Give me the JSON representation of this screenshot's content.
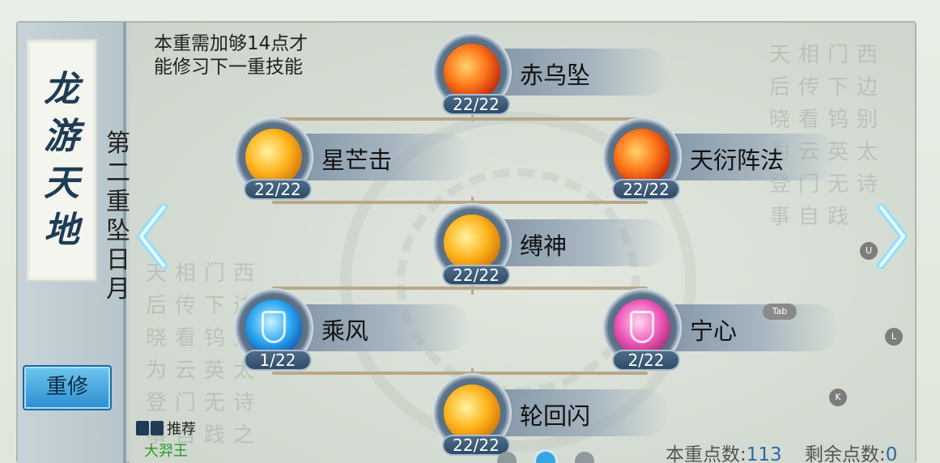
{
  "side_banner": {
    "calligraphy": [
      "龙",
      "游",
      "天",
      "地"
    ],
    "title_chars": [
      "第",
      "二",
      "重",
      "坠",
      "日",
      "月"
    ],
    "reset_label": "重修"
  },
  "hint": {
    "line1": "本重需加够14点才",
    "line2": "能修习下一重技能"
  },
  "deco_poem": {
    "right": [
      "天相门西",
      "后传下边",
      "晓看钨别",
      "为云英太",
      "登门无诗",
      "事自践"
    ],
    "left": [
      "天相门西",
      "后传下边",
      "晓看钨别",
      "为云英太",
      "登门无诗",
      "事自践之"
    ]
  },
  "skills": [
    {
      "name": "赤乌坠",
      "level": "22/22",
      "icon": "fire-claw-icon"
    },
    {
      "name": "星芒击",
      "level": "22/22",
      "icon": "golden-star-strike-icon"
    },
    {
      "name": "天衍阵法",
      "level": "22/22",
      "icon": "fire-formation-icon"
    },
    {
      "name": "缚神",
      "level": "22/22",
      "icon": "golden-bind-icon"
    },
    {
      "name": "乘风",
      "level": "1/22",
      "icon": "blue-shield-icon"
    },
    {
      "name": "宁心",
      "level": "2/22",
      "icon": "pink-shield-icon"
    },
    {
      "name": "轮回闪",
      "level": "22/22",
      "icon": "fire-phoenix-icon"
    }
  ],
  "key_hints": {
    "u": "U",
    "l": "L",
    "k": "K",
    "tab": "Tab"
  },
  "recommend": {
    "label": "推荐",
    "name": "大羿王"
  },
  "points": {
    "current_label": "本重点数:",
    "current_value": "113",
    "remaining_label": "剩余点数:",
    "remaining_value": "0"
  },
  "colors": {
    "accent_blue": "#3aa3e2",
    "recommend_green": "#2a9a2a",
    "value_blue": "#2b6aa8"
  }
}
